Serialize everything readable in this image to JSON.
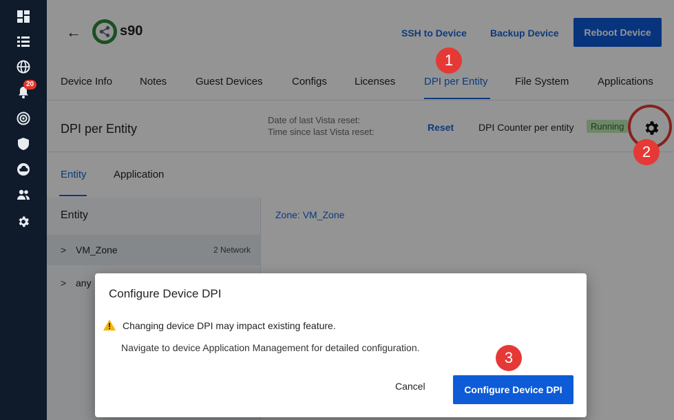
{
  "rail": {
    "icons": [
      "dashboard-icon",
      "list-icon",
      "globe-icon",
      "bell-icon",
      "radar-icon",
      "shield-icon",
      "cloud-icon",
      "users-icon",
      "settings-icon"
    ],
    "notification_count": "20"
  },
  "header": {
    "back": "←",
    "device_name": "s90",
    "ssh_label": "SSH to Device",
    "backup_label": "Backup Device",
    "reboot_label": "Reboot Device"
  },
  "tabs": [
    {
      "label": "Device Info"
    },
    {
      "label": "Notes"
    },
    {
      "label": "Guest Devices"
    },
    {
      "label": "Configs"
    },
    {
      "label": "Licenses"
    },
    {
      "label": "DPI per Entity"
    },
    {
      "label": "File System"
    },
    {
      "label": "Applications"
    }
  ],
  "section": {
    "title": "DPI per Entity",
    "vista_reset_label": "Date of last Vista reset:",
    "vista_time_label": "Time since last Vista reset:",
    "reset_label": "Reset",
    "dpi_counter_label": "DPI Counter per entity",
    "status": "Running"
  },
  "subtabs": [
    {
      "label": "Entity"
    },
    {
      "label": "Application"
    }
  ],
  "entity": {
    "header": "Entity",
    "rows": [
      {
        "chevron": ">",
        "name": "VM_Zone",
        "count": "2 Network"
      },
      {
        "chevron": ">",
        "name": "any",
        "count": ""
      }
    ],
    "zone_link": "Zone: VM_Zone"
  },
  "modal": {
    "title": "Configure Device DPI",
    "warning": "Changing device DPI may impact existing feature.",
    "navigate": "Navigate to device Application Management for detailed configuration.",
    "cancel_label": "Cancel",
    "confirm_label": "Configure Device DPI"
  },
  "steps": [
    "1",
    "2",
    "3"
  ],
  "colors": {
    "accent": "#1565d8",
    "primary_button": "#0d5bd7",
    "step_marker": "#e53935",
    "running_bg": "#bfe8b6",
    "rail_bg": "#0f1a2a"
  }
}
